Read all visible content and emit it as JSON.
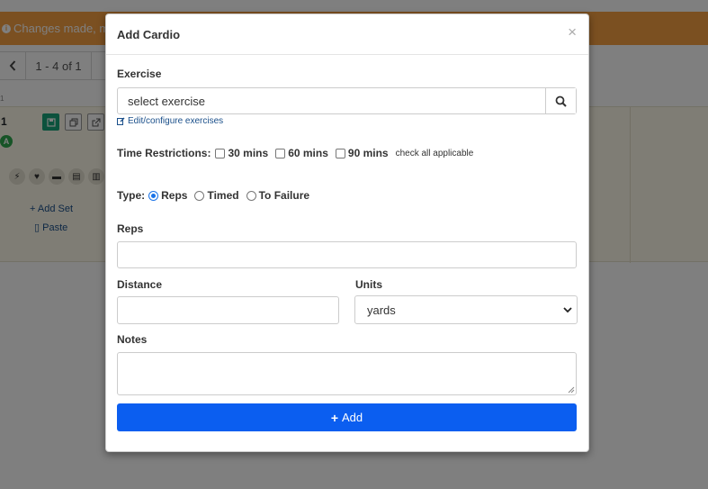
{
  "background": {
    "alert_text": "Changes made, m",
    "pager": {
      "prev_icon": "chevron-left-icon",
      "range": "1 - 4 of 1"
    },
    "tiny_label": "1",
    "card_number": "1",
    "badge": "A",
    "add_set": "Add Set",
    "paste": "Paste"
  },
  "modal": {
    "title": "Add Cardio",
    "close": "×",
    "exercise": {
      "label": "Exercise",
      "value": "select exercise",
      "edit_link": "Edit/configure exercises"
    },
    "time_restrictions": {
      "label": "Time Restrictions:",
      "options": [
        "30 mins",
        "60 mins",
        "90 mins"
      ],
      "hint": "check all applicable"
    },
    "type": {
      "label": "Type:",
      "options": [
        "Reps",
        "Timed",
        "To Failure"
      ],
      "selected": "Reps"
    },
    "reps": {
      "label": "Reps",
      "value": ""
    },
    "distance": {
      "label": "Distance",
      "value": ""
    },
    "units": {
      "label": "Units",
      "selected": "yards"
    },
    "notes": {
      "label": "Notes",
      "value": ""
    },
    "add_button": "Add"
  },
  "colors": {
    "alert": "#f6a043",
    "primary": "#0b5ef0",
    "success": "#18a57a",
    "link": "#1a4f8a"
  }
}
